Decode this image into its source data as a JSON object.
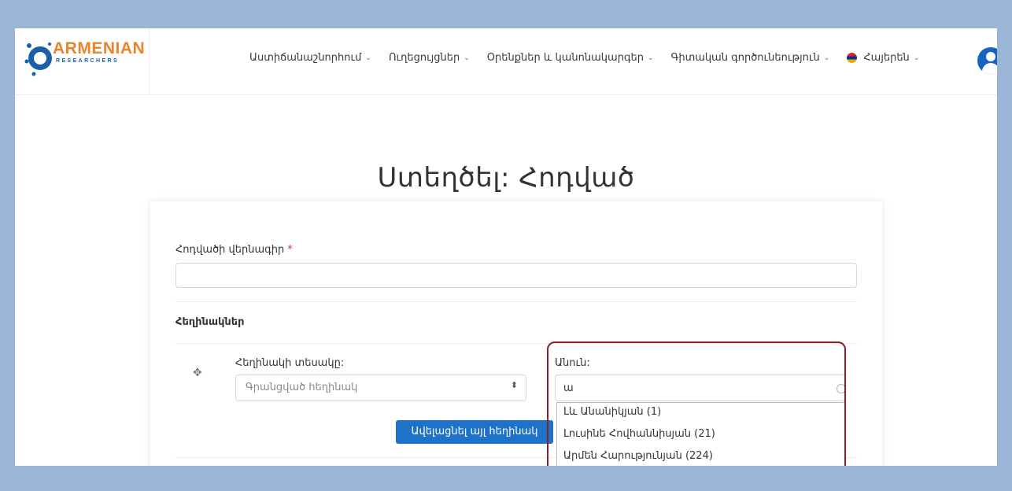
{
  "brand": {
    "name": "ARMENIAN",
    "tagline": "RESEARCHERS"
  },
  "nav": {
    "items": [
      {
        "label": "Աստիճանաշնորհում"
      },
      {
        "label": "Ուղեցույցներ"
      },
      {
        "label": "Օրենքներ և կանոնակարգեր"
      },
      {
        "label": "Գիտական գործունեություն"
      }
    ],
    "language": "Հայերեն",
    "chevron": "⌄"
  },
  "page": {
    "title": "Ստեղծել: Հոդված"
  },
  "form": {
    "title_label": "Հոդվածի վերնագիր",
    "required_mark": "*",
    "title_value": "",
    "authors_section": "Հեղինակներ",
    "author_type_label": "Հեղինակի տեսակը:",
    "author_type_selected": "Գրանցված հեղինակ",
    "name_label": "Անուն:",
    "name_value": "ա",
    "add_button": "Ավելացնել այլ հեղինակ",
    "suggestions": [
      "Լև Անանիկյան (1)",
      "Լուսինե Հովհաննիսյան (21)",
      "Արմեն Հարությունյան (224)"
    ]
  },
  "colors": {
    "accent": "#1e73c8",
    "highlight": "#8b1f2e",
    "background": "#9bb5d6",
    "brand_orange": "#e8852a"
  },
  "icons": {
    "drag": "move-icon",
    "select": "updown-arrows-icon",
    "user": "user-avatar-icon",
    "flag": "armenia-flag-icon"
  }
}
